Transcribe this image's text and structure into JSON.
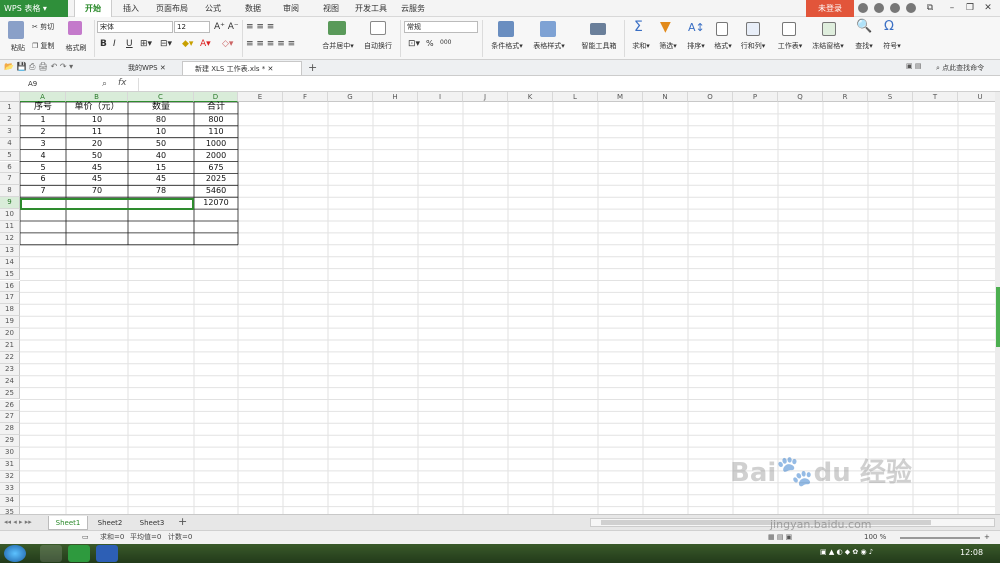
{
  "app": {
    "name": "WPS 表格",
    "login": "未登录"
  },
  "menu_tabs": [
    "开始",
    "插入",
    "页面布局",
    "公式",
    "数据",
    "审阅",
    "视图",
    "开发工具",
    "云服务"
  ],
  "ribbon": {
    "paste": "粘贴",
    "cut": "剪切",
    "copy": "复制",
    "format_painter": "格式刷",
    "font_name": "宋体",
    "font_size": "12",
    "bold": "B",
    "italic": "I",
    "underline": "U",
    "merge": "合并居中",
    "wrap": "自动换行",
    "number_format": "常规",
    "percent": "%",
    "thousands": "000",
    "cond_format": "条件格式",
    "table_style": "表格样式",
    "smart_tools": "智能工具箱",
    "sum": "求和",
    "filter": "筛选",
    "sort": "排序",
    "format": "格式",
    "rowcol": "行和列",
    "worksheet": "工作表",
    "freeze": "冻结窗格",
    "find": "查找",
    "symbol": "符号"
  },
  "doc_tabs": [
    "我的WPS",
    "新建 XLS 工作表.xls *"
  ],
  "search_cmd": "点此查找命令",
  "namebox": "A9",
  "fx": "fx",
  "columns": [
    "A",
    "B",
    "C",
    "D",
    "E",
    "F",
    "G",
    "H",
    "I",
    "J",
    "K",
    "L",
    "M",
    "N",
    "O",
    "P",
    "Q",
    "R",
    "S",
    "T",
    "U"
  ],
  "rows": [
    "1",
    "2",
    "3",
    "4",
    "5",
    "6",
    "7",
    "8",
    "9",
    "10",
    "11",
    "12",
    "13",
    "14",
    "15",
    "16",
    "17",
    "18",
    "19",
    "20",
    "21",
    "22",
    "23",
    "24",
    "25",
    "26",
    "27",
    "28",
    "29",
    "30",
    "31",
    "32",
    "33",
    "34",
    "35"
  ],
  "table": {
    "headers": [
      "序号",
      "单价（元）",
      "数量",
      "合计"
    ],
    "rows": [
      [
        "1",
        "10",
        "80",
        "800"
      ],
      [
        "2",
        "11",
        "10",
        "110"
      ],
      [
        "3",
        "20",
        "50",
        "1000"
      ],
      [
        "4",
        "50",
        "40",
        "2000"
      ],
      [
        "5",
        "45",
        "15",
        "675"
      ],
      [
        "6",
        "45",
        "45",
        "2025"
      ],
      [
        "7",
        "70",
        "78",
        "5460"
      ],
      [
        "",
        "",
        "",
        "12070"
      ]
    ]
  },
  "sheets": [
    "Sheet1",
    "Sheet2",
    "Sheet3"
  ],
  "status": {
    "sum": "求和=0",
    "avg": "平均值=0",
    "count": "计数=0",
    "zoom": "100 %"
  },
  "clock": "12:08",
  "watermark": "Bai du 经验",
  "watermark_url": "jingyan.baidu.com",
  "colors": {
    "accent": "#2e8b2e",
    "login": "#e2553a"
  }
}
